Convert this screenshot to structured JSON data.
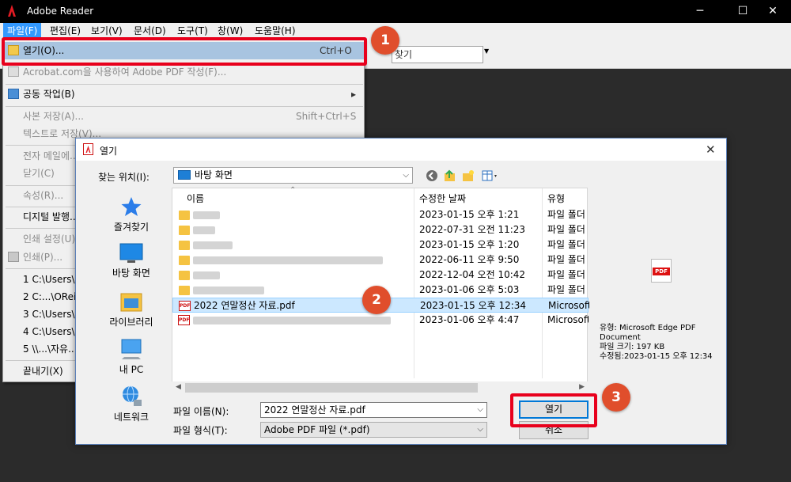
{
  "app": {
    "title": "Adobe Reader"
  },
  "menubar": [
    "파일(F)",
    "편집(E)",
    "보기(V)",
    "문서(D)",
    "도구(T)",
    "창(W)",
    "도움말(H)"
  ],
  "toolbar": {
    "search_placeholder": "찾기"
  },
  "file_menu": {
    "open": {
      "label": "열기(O)...",
      "shortcut": "Ctrl+O"
    },
    "acrobat": {
      "label": "Acrobat.com을 사용하여 Adobe PDF 작성(F)..."
    },
    "collab": {
      "label": "공동 작업(B)"
    },
    "save_copy": {
      "label": "사본 저장(A)...",
      "shortcut": "Shift+Ctrl+S"
    },
    "save_text": {
      "label": "텍스트로 저장(V)..."
    },
    "email": {
      "label": "전자 메일에..."
    },
    "close": {
      "label": "닫기(C)"
    },
    "properties": {
      "label": "속성(R)..."
    },
    "digital": {
      "label": "디지털 발행..."
    },
    "print_setup": {
      "label": "인쇄 설정(U)..."
    },
    "print": {
      "label": "인쇄(P)..."
    },
    "recent": [
      "1 C:\\Users\\...",
      "2 C:...\\OReil...",
      "3 C:\\Users\\...",
      "4 C:\\Users\\...",
      "5 \\\\...\\자유..."
    ],
    "exit": {
      "label": "끝내기(X)"
    }
  },
  "dialog": {
    "title": "열기",
    "look_in_label": "찾는 위치(I):",
    "look_in_value": "바탕 화면",
    "places": [
      "즐겨찾기",
      "바탕 화면",
      "라이브러리",
      "내 PC",
      "네트워크"
    ],
    "columns": {
      "name": "이름",
      "date": "수정한 날짜",
      "type": "유형"
    },
    "rows": [
      {
        "name": "",
        "date": "2023-01-15 오후 1:21",
        "type": "파일 폴더"
      },
      {
        "name": "",
        "date": "2022-07-31 오전 11:23",
        "type": "파일 폴더"
      },
      {
        "name": "",
        "date": "2023-01-15 오후 1:20",
        "type": "파일 폴더"
      },
      {
        "name": "",
        "date": "2022-06-11 오후 9:50",
        "type": "파일 폴더"
      },
      {
        "name": "",
        "date": "2022-12-04 오전 10:42",
        "type": "파일 폴더"
      },
      {
        "name": "",
        "date": "2023-01-06 오후 5:03",
        "type": "파일 폴더"
      },
      {
        "name": "2022 연말정산 자료.pdf",
        "date": "2023-01-15 오후 12:34",
        "type": "Microsoft"
      },
      {
        "name": "",
        "date": "2023-01-06 오후 4:47",
        "type": "Microsoft"
      }
    ],
    "preview": {
      "type": "유형: Microsoft Edge PDF Document",
      "size": "파일 크기: 197 KB",
      "modified": "수정됨:2023-01-15 오후 12:34"
    },
    "filename_label": "파일 이름(N):",
    "filename_value": "2022 연말정산 자료.pdf",
    "filetype_label": "파일 형식(T):",
    "filetype_value": "Adobe PDF 파일 (*.pdf)",
    "open_button": "열기",
    "cancel_button": "취소"
  },
  "badges": [
    "1",
    "2",
    "3"
  ],
  "colors": {
    "highlight_red": "#e8001c",
    "badge": "#e04e2c",
    "selection": "#cce8ff"
  }
}
